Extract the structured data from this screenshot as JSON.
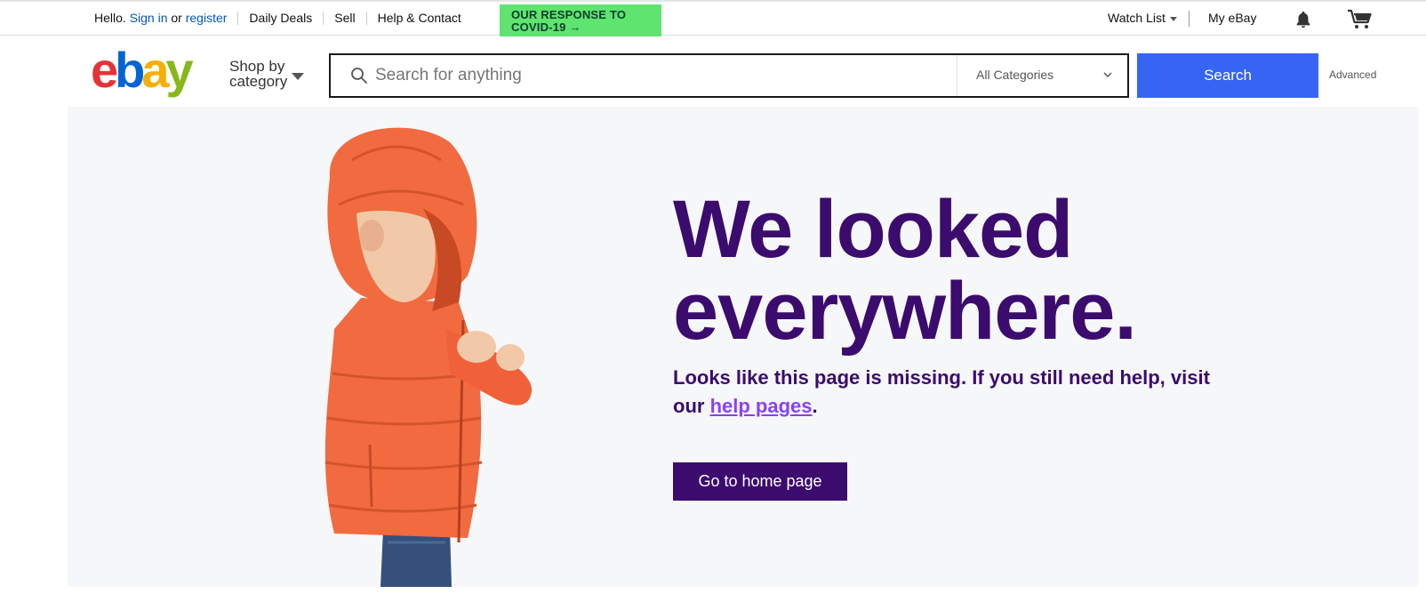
{
  "topbar": {
    "hello": "Hello.",
    "sign_in": "Sign in",
    "or": "or",
    "register": "register",
    "daily_deals": "Daily Deals",
    "sell": "Sell",
    "help_contact": "Help & Contact",
    "covid_banner_line1": "OUR RESPONSE TO",
    "covid_banner_line2": "COVID-19 →",
    "watch_list": "Watch List",
    "my_ebay": "My eBay"
  },
  "header": {
    "logo_text": "ebay",
    "shop_by_line1": "Shop by",
    "shop_by_line2": "category",
    "search_placeholder": "Search for anything",
    "category_selected": "All Categories",
    "search_button": "Search",
    "advanced": "Advanced"
  },
  "hero": {
    "headline_line1": "We looked",
    "headline_line2": "everywhere.",
    "message_part1": "Looks like this page is missing. If you still need help, visit our ",
    "help_link": "help pages",
    "message_part2": ".",
    "home_button": "Go to home page"
  },
  "colors": {
    "accent_blue": "#3665f3",
    "link_blue": "#0654ba",
    "covid_green": "#5ee46f",
    "brand_purple": "#3b0b6e",
    "link_purple": "#8a3ffc",
    "hero_bg": "#f6f7f9",
    "jacket_orange": "#f26a3f"
  },
  "icons": [
    "search-icon",
    "bell-icon",
    "cart-icon",
    "chevron-down-icon",
    "caret-down-icon"
  ]
}
